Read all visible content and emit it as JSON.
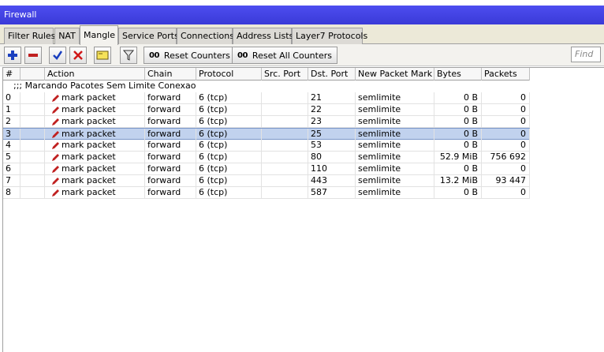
{
  "window": {
    "title": "Firewall"
  },
  "tabs": [
    {
      "label": "Filter Rules",
      "active": false
    },
    {
      "label": "NAT",
      "active": false
    },
    {
      "label": "Mangle",
      "active": true
    },
    {
      "label": "Service Ports",
      "active": false
    },
    {
      "label": "Connections",
      "active": false
    },
    {
      "label": "Address Lists",
      "active": false
    },
    {
      "label": "Layer7 Protocols",
      "active": false
    }
  ],
  "toolbar": {
    "add_icon": "plus-icon",
    "remove_icon": "minus-icon",
    "enable_icon": "check-icon",
    "disable_icon": "x-icon",
    "comment_icon": "note-icon",
    "filter_icon": "funnel-icon",
    "reset_counters_glyph": "00",
    "reset_counters_label": "Reset Counters",
    "reset_all_glyph": "00",
    "reset_all_label": "Reset All Counters",
    "find_placeholder": "Find"
  },
  "table": {
    "headers": [
      "#",
      "",
      "Action",
      "Chain",
      "Protocol",
      "Src. Port",
      "Dst. Port",
      "New Packet Mark",
      "Bytes",
      "Packets"
    ],
    "comment": ";;; Marcando Pacotes Sem Limite Conexao",
    "rows": [
      {
        "num": "0",
        "action": "mark packet",
        "chain": "forward",
        "protocol": "6 (tcp)",
        "src_port": "",
        "dst_port": "21",
        "mark": "semlimite",
        "bytes": "0 B",
        "packets": "0"
      },
      {
        "num": "1",
        "action": "mark packet",
        "chain": "forward",
        "protocol": "6 (tcp)",
        "src_port": "",
        "dst_port": "22",
        "mark": "semlimite",
        "bytes": "0 B",
        "packets": "0"
      },
      {
        "num": "2",
        "action": "mark packet",
        "chain": "forward",
        "protocol": "6 (tcp)",
        "src_port": "",
        "dst_port": "23",
        "mark": "semlimite",
        "bytes": "0 B",
        "packets": "0"
      },
      {
        "num": "3",
        "action": "mark packet",
        "chain": "forward",
        "protocol": "6 (tcp)",
        "src_port": "",
        "dst_port": "25",
        "mark": "semlimite",
        "bytes": "0 B",
        "packets": "0"
      },
      {
        "num": "4",
        "action": "mark packet",
        "chain": "forward",
        "protocol": "6 (tcp)",
        "src_port": "",
        "dst_port": "53",
        "mark": "semlimite",
        "bytes": "0 B",
        "packets": "0"
      },
      {
        "num": "5",
        "action": "mark packet",
        "chain": "forward",
        "protocol": "6 (tcp)",
        "src_port": "",
        "dst_port": "80",
        "mark": "semlimite",
        "bytes": "52.9 MiB",
        "packets": "756 692"
      },
      {
        "num": "6",
        "action": "mark packet",
        "chain": "forward",
        "protocol": "6 (tcp)",
        "src_port": "",
        "dst_port": "110",
        "mark": "semlimite",
        "bytes": "0 B",
        "packets": "0"
      },
      {
        "num": "7",
        "action": "mark packet",
        "chain": "forward",
        "protocol": "6 (tcp)",
        "src_port": "",
        "dst_port": "443",
        "mark": "semlimite",
        "bytes": "13.2 MiB",
        "packets": "93 447"
      },
      {
        "num": "8",
        "action": "mark packet",
        "chain": "forward",
        "protocol": "6 (tcp)",
        "src_port": "",
        "dst_port": "587",
        "mark": "semlimite",
        "bytes": "0 B",
        "packets": "0"
      }
    ],
    "selected_row": 3
  },
  "colors": {
    "titlebar": "#4545e6",
    "selection": "#c1d2ee",
    "pencil": "#c02020"
  }
}
